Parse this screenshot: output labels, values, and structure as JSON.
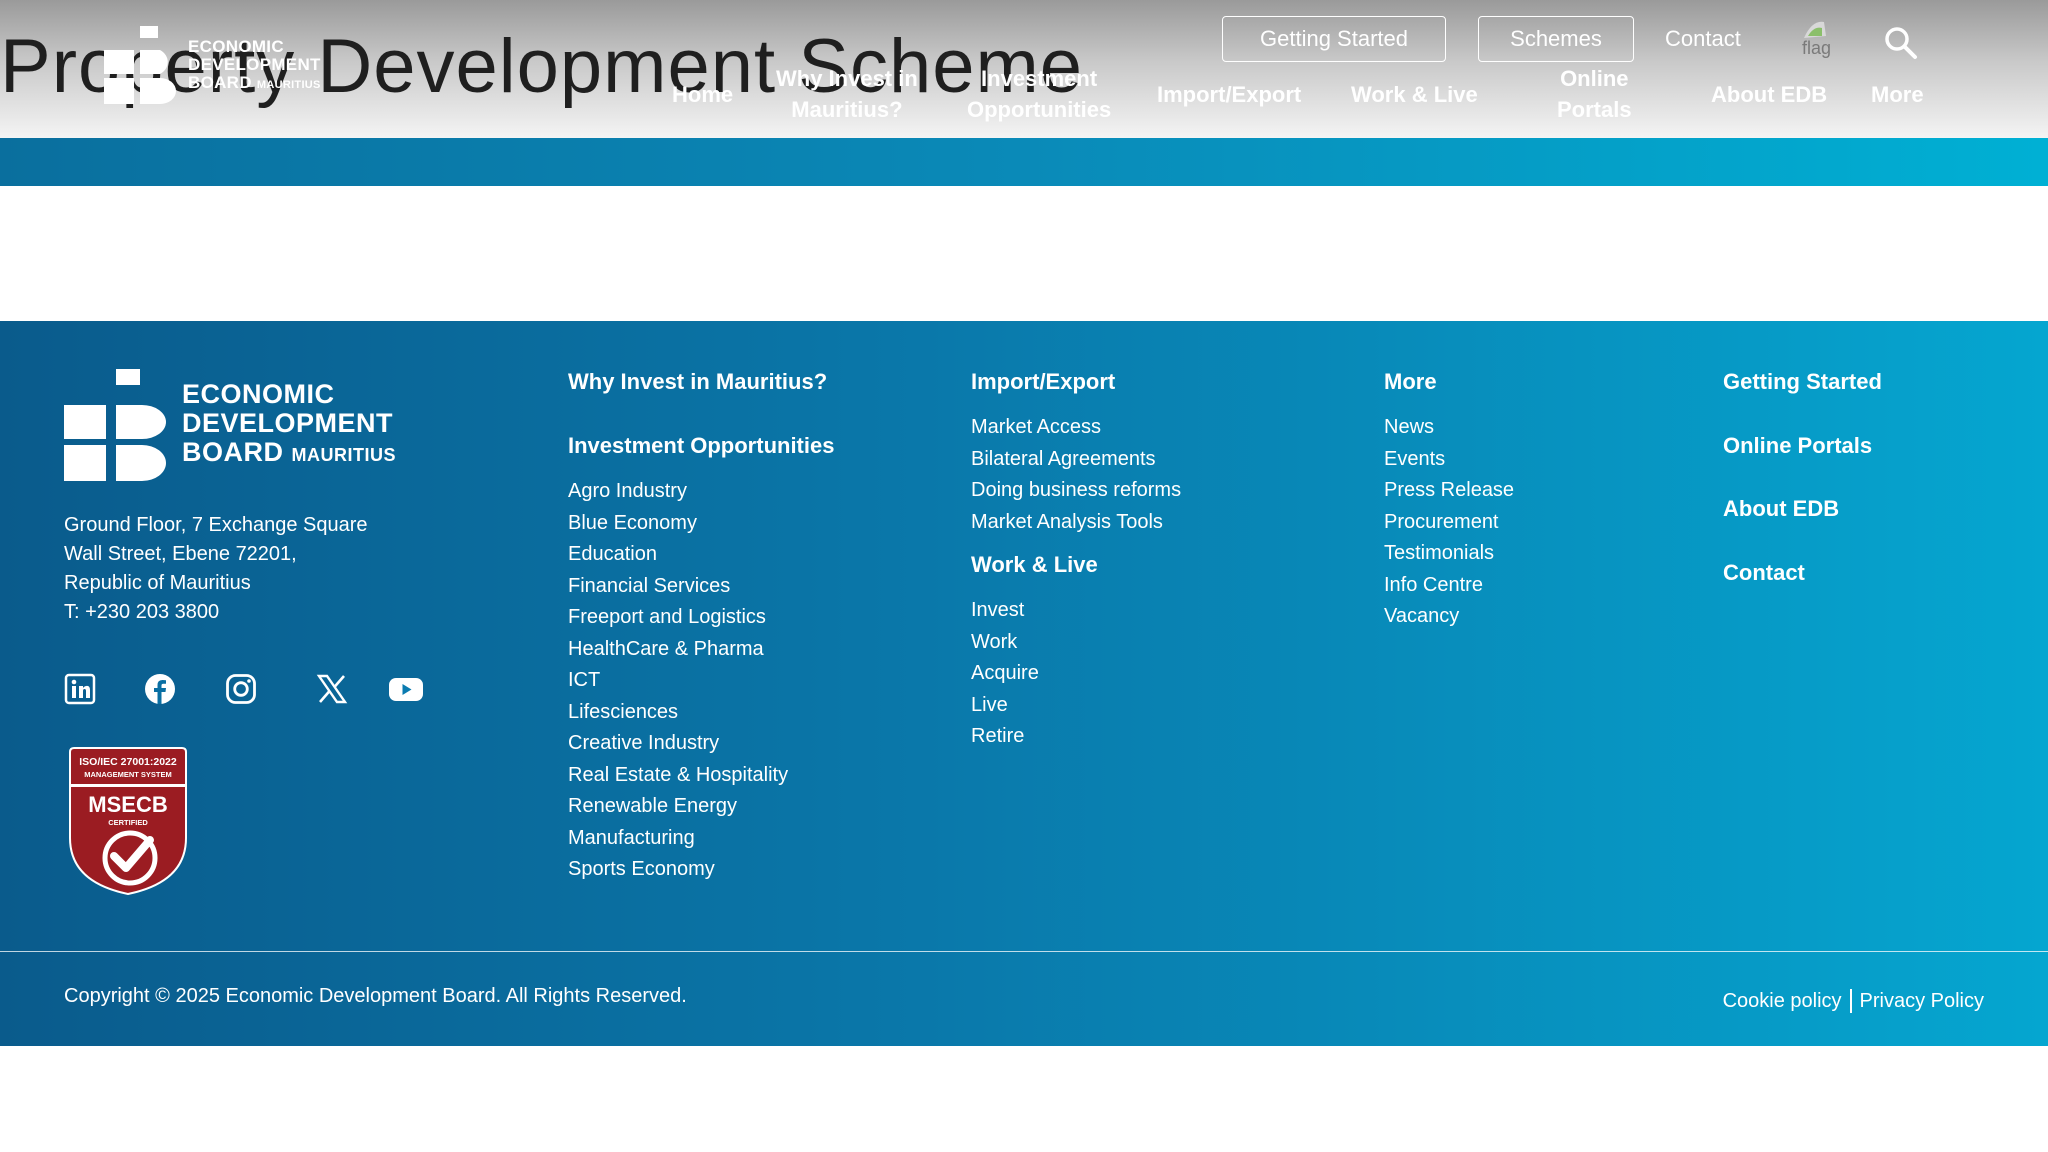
{
  "header": {
    "page_title": "Property Development Scheme",
    "logo": {
      "line1": "ECONOMIC",
      "line2": "DEVELOPMENT",
      "line3": "BOARD",
      "line3_small": "MAURITIUS"
    },
    "top_buttons": {
      "getting_started": "Getting Started",
      "schemes": "Schemes"
    },
    "contact": "Contact",
    "flag_alt": "flag",
    "nav": {
      "home": "Home",
      "why_invest_1": "Why Invest in",
      "why_invest_2": "Mauritius?",
      "invest_opp_1": "Investment",
      "invest_opp_2": "Opportunities",
      "import_export": "Import/Export",
      "work_live": "Work & Live",
      "online_portals_1": "Online",
      "online_portals_2": "Portals",
      "about": "About EDB",
      "more": "More"
    }
  },
  "footer": {
    "logo": {
      "line1": "ECONOMIC",
      "line2": "DEVELOPMENT",
      "line3": "BOARD",
      "line3_small": "MAURITIUS"
    },
    "address": {
      "line1": "Ground Floor, 7 Exchange Square",
      "line2": "Wall Street, Ebene 72201,",
      "line3": "Republic of Mauritius",
      "phone": "T: +230 203 3800"
    },
    "badge": {
      "line1": "ISO/IEC 27001:2022",
      "line2": "MANAGEMENT SYSTEM",
      "line3": "MSECB",
      "line4": "CERTIFIED"
    },
    "col1": {
      "head1": "Why Invest in Mauritius?",
      "head2": "Investment Opportunities",
      "items": [
        "Agro Industry",
        "Blue Economy",
        "Education",
        "Financial Services",
        "Freeport and Logistics",
        "HealthCare & Pharma",
        "ICT",
        "Lifesciences",
        "Creative Industry",
        "Real Estate & Hospitality",
        "Renewable Energy",
        "Manufacturing",
        "Sports Economy"
      ]
    },
    "col2": {
      "head1": "Import/Export",
      "items1": [
        "Market Access",
        "Bilateral Agreements",
        "Doing business reforms",
        "Market Analysis Tools"
      ],
      "head2": "Work & Live",
      "items2": [
        "Invest",
        "Work",
        "Acquire",
        "Live",
        "Retire"
      ]
    },
    "col3": {
      "head": "More",
      "items": [
        "News",
        "Events",
        "Press Release",
        "Procurement",
        "Testimonials",
        "Info Centre",
        "Vacancy"
      ]
    },
    "col4": {
      "heads": [
        "Getting Started",
        "Online Portals",
        "About EDB",
        "Contact"
      ]
    },
    "copyright": "Copyright © 2025 Economic Development Board. All Rights Reserved.",
    "cookie_policy": "Cookie policy",
    "privacy_policy": "Privacy Policy"
  },
  "colors": {
    "footer_start": "#0a5b8c",
    "footer_end": "#05a6d0",
    "badge_red": "#9b1c22"
  }
}
